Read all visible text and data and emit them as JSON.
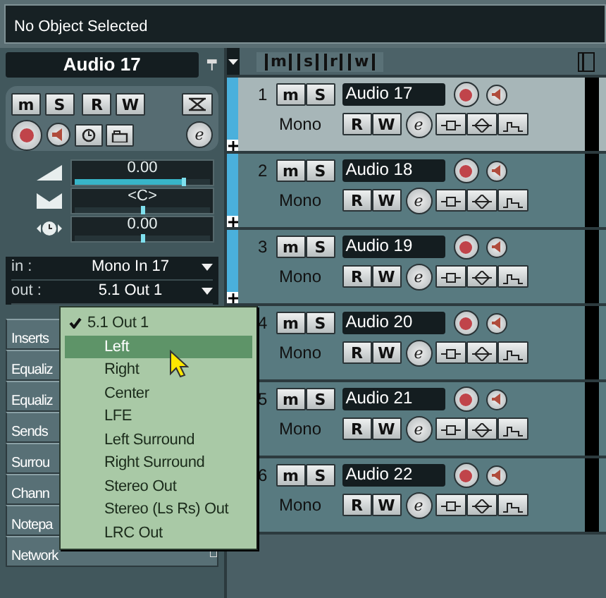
{
  "status_bar": {
    "text": "No Object Selected"
  },
  "inspector": {
    "title": "Audio 17",
    "mute": "m",
    "solo": "S",
    "read": "R",
    "write": "W",
    "edit": "e",
    "sliders": [
      {
        "kind": "volume",
        "reading": "0.00",
        "level": 0.8
      },
      {
        "kind": "pan",
        "reading": "<C>",
        "level": 0.5
      },
      {
        "kind": "delay",
        "reading": "0.00",
        "level": 0.5
      }
    ],
    "routing": [
      {
        "label": "in :",
        "value": "Mono In 17"
      },
      {
        "label": "out :",
        "value": "5.1 Out 1"
      }
    ],
    "sections": [
      "Inserts",
      "Equaliz",
      "Equaliz",
      "Sends",
      "Surrou",
      "Chann",
      "Notepa",
      "Network"
    ]
  },
  "track_header": {
    "filters": [
      "m",
      "s",
      "r",
      "w"
    ]
  },
  "tracks": [
    {
      "number": "1",
      "name": "Audio 17",
      "channel": "Mono",
      "selected": true,
      "mute": "m",
      "solo": "S",
      "read": "R",
      "write": "W",
      "edit": "e"
    },
    {
      "number": "2",
      "name": "Audio 18",
      "channel": "Mono",
      "selected": false,
      "mute": "m",
      "solo": "S",
      "read": "R",
      "write": "W",
      "edit": "e"
    },
    {
      "number": "3",
      "name": "Audio 19",
      "channel": "Mono",
      "selected": false,
      "mute": "m",
      "solo": "S",
      "read": "R",
      "write": "W",
      "edit": "e"
    },
    {
      "number": "4",
      "name": "Audio 20",
      "channel": "Mono",
      "selected": false,
      "mute": "m",
      "solo": "S",
      "read": "R",
      "write": "W",
      "edit": "e"
    },
    {
      "number": "5",
      "name": "Audio 21",
      "channel": "Mono",
      "selected": false,
      "mute": "m",
      "solo": "S",
      "read": "R",
      "write": "W",
      "edit": "e"
    },
    {
      "number": "6",
      "name": "Audio 22",
      "channel": "Mono",
      "selected": false,
      "mute": "m",
      "solo": "S",
      "read": "R",
      "write": "W",
      "edit": "e"
    }
  ],
  "output_menu": [
    {
      "label": "5.1 Out 1",
      "checked": true,
      "selected": false
    },
    {
      "label": "Left",
      "checked": false,
      "selected": true
    },
    {
      "label": "Right",
      "checked": false,
      "selected": false
    },
    {
      "label": "Center",
      "checked": false,
      "selected": false
    },
    {
      "label": "LFE",
      "checked": false,
      "selected": false
    },
    {
      "label": "Left Surround",
      "checked": false,
      "selected": false
    },
    {
      "label": "Right Surround",
      "checked": false,
      "selected": false
    },
    {
      "label": "Stereo Out",
      "checked": false,
      "selected": false
    },
    {
      "label": "Stereo (Ls Rs) Out",
      "checked": false,
      "selected": false
    },
    {
      "label": "LRC Out",
      "checked": false,
      "selected": false
    }
  ]
}
